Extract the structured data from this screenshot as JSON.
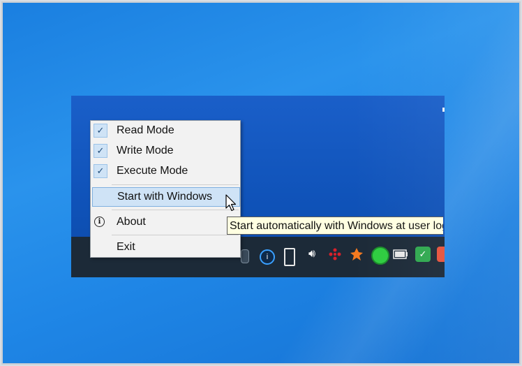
{
  "menu": {
    "items": [
      {
        "label": "Read Mode",
        "checked": true
      },
      {
        "label": "Write Mode",
        "checked": true
      },
      {
        "label": "Execute Mode",
        "checked": true
      },
      {
        "label": "Start with Windows",
        "highlighted": true
      },
      {
        "label": "About",
        "icon": "info-icon"
      },
      {
        "label": "Exit"
      }
    ]
  },
  "tooltip": {
    "text": "Start automatically with Windows at user logon"
  },
  "tray": {
    "icons": [
      "battery-icon",
      "generic-app-icon",
      "usb-drive-icon",
      "volume-icon",
      "cluster-app-icon",
      "avast-icon",
      "green-circle-icon",
      "battery-meter-icon",
      "security-check-icon",
      "partial-app-icon"
    ]
  },
  "colors": {
    "desktop_blue": "#1f86e6",
    "taskbar": "#1c2a38",
    "menu_bg": "#f2f2f2",
    "highlight": "#cfe3f6",
    "tooltip_bg": "#ffffe1"
  }
}
